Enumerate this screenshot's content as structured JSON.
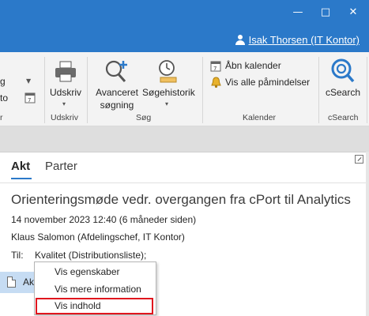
{
  "window": {
    "minimize_glyph": "—",
    "maximize_glyph": "□",
    "close_glyph": "✕",
    "user_name": "Isak Thorsen (IT Kontor)"
  },
  "ribbon": {
    "left_partial": {
      "item1": "g",
      "item2": "to",
      "group_label": "r"
    },
    "print": {
      "label": "Udskriv",
      "group_label": "Udskriv"
    },
    "search": {
      "advanced_label_line1": "Avanceret",
      "advanced_label_line2": "søgning",
      "history_label": "Søgehistorik",
      "group_label": "Søg"
    },
    "calendar": {
      "open_label": "Åbn kalender",
      "reminders_label": "Vis alle påmindelser",
      "group_label": "Kalender"
    },
    "csearch": {
      "label": "cSearch",
      "group_label": "cSearch"
    }
  },
  "pane": {
    "tabs": [
      "Akt",
      "Parter"
    ],
    "subject": "Orienteringsmøde vedr. overgangen fra cPort til Analytics",
    "date": "14 november 2023 12:40 (6 måneder siden)",
    "sender": "Klaus Salomon (Afdelingschef, IT Kontor)",
    "to_label": "Til:",
    "to_value": "Kvalitet (Distributionsliste);",
    "attachment_label": "Ak"
  },
  "context_menu": {
    "items": [
      "Vis egenskaber",
      "Vis mere information",
      "Vis indhold"
    ],
    "highlight_color": "#e0161e"
  },
  "colors": {
    "titlebar": "#2b79c9",
    "ribbon": "#f3f3f3",
    "strip": "#dedede",
    "accent": "#2b79c9"
  }
}
